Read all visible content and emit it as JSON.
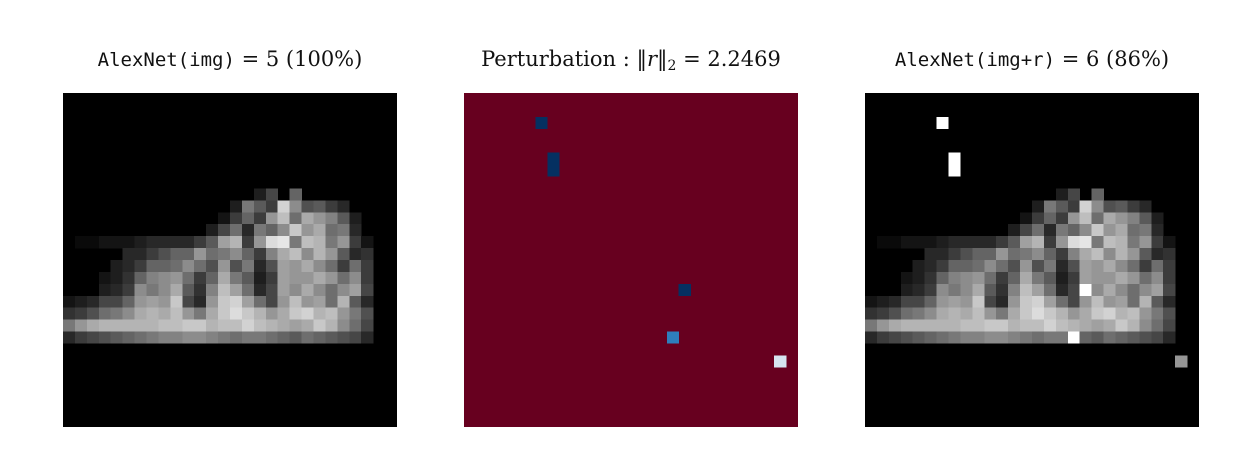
{
  "figure": {
    "panels": [
      {
        "title_func": "AlexNet(img)",
        "title_eq": " = 5 ",
        "title_conf": "(100%)",
        "colormap": "gray"
      },
      {
        "title_text": "Perturbation : ",
        "title_norm_open": "‖",
        "title_norm_var": "r",
        "title_norm_close": "‖",
        "title_norm_sub": "2",
        "title_eq": " = 2.2469",
        "colormap": "diverging-red-blue"
      },
      {
        "title_func": "AlexNet(img+r)",
        "title_eq": " = 6 ",
        "title_conf": "(86%)",
        "colormap": "gray"
      }
    ]
  },
  "colors": {
    "perturb_background": "#67001f",
    "perturb_dark_blue": "#053061",
    "perturb_mid_blue": "#2e7ebc",
    "perturb_light_blue": "#d6e5f0"
  }
}
